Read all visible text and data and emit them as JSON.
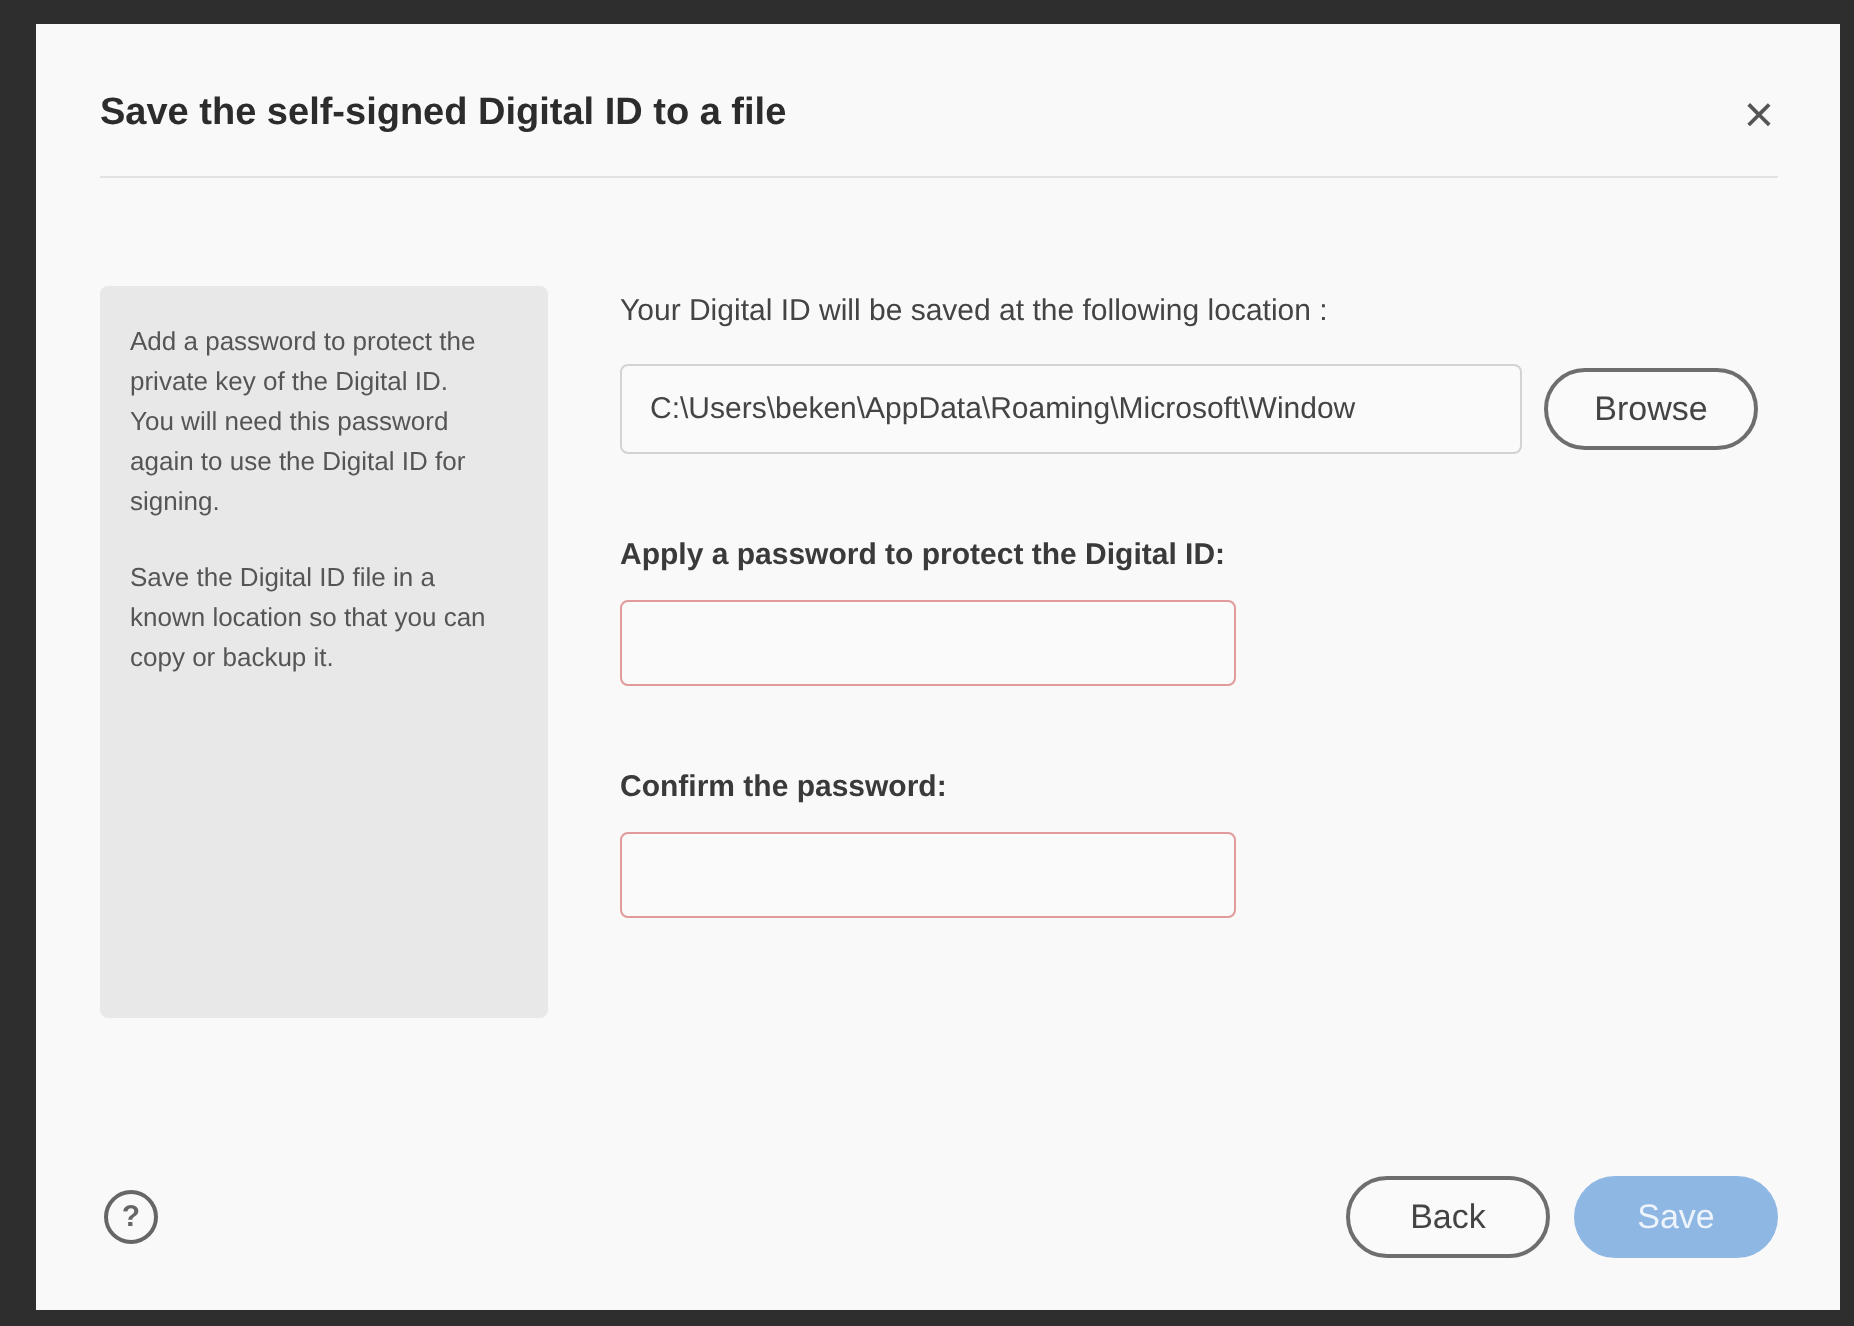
{
  "dialog": {
    "title": "Save the self-signed Digital ID to a file",
    "close": "×"
  },
  "info_panel": {
    "paragraphs": [
      "Add a password to protect the private key of the Digital ID. You will need this password again to use the Digital ID for signing.",
      "Save the Digital ID file in a known location so that you can copy or backup it."
    ]
  },
  "location": {
    "label": "Your Digital ID will be saved at the following location :",
    "value": "C:\\Users\\beken\\AppData\\Roaming\\Microsoft\\Window",
    "browse": "Browse"
  },
  "fields": [
    {
      "label": "Apply a password to protect the Digital ID:",
      "invalid": true
    },
    {
      "label": "Confirm the password:",
      "invalid": true
    }
  ],
  "footer": {
    "help": "?",
    "buttons": [
      {
        "label": "Back",
        "kind": "secondary",
        "disabled": false
      },
      {
        "label": "Save",
        "kind": "primary",
        "disabled": true
      }
    ]
  }
}
